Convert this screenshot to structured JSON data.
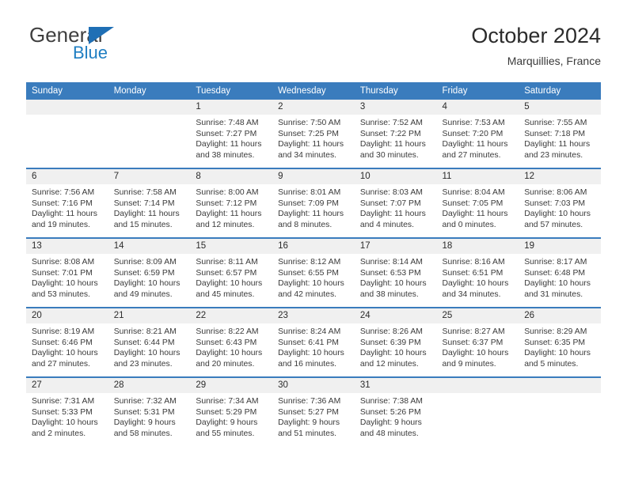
{
  "brand": {
    "name_part1": "General",
    "name_part2": "Blue"
  },
  "header": {
    "title": "October 2024",
    "subtitle": "Marquillies, France"
  },
  "colors": {
    "header_blue": "#3a7cbd",
    "brand_blue": "#1f7ec2",
    "daynum_band": "#f0f0f0",
    "text": "#3a3a3a"
  },
  "weekday_headers": [
    "Sunday",
    "Monday",
    "Tuesday",
    "Wednesday",
    "Thursday",
    "Friday",
    "Saturday"
  ],
  "weeks": [
    [
      {
        "day": "",
        "sunrise": "",
        "sunset": "",
        "daylight_line1": "",
        "daylight_line2": ""
      },
      {
        "day": "",
        "sunrise": "",
        "sunset": "",
        "daylight_line1": "",
        "daylight_line2": ""
      },
      {
        "day": "1",
        "sunrise": "Sunrise: 7:48 AM",
        "sunset": "Sunset: 7:27 PM",
        "daylight_line1": "Daylight: 11 hours",
        "daylight_line2": "and 38 minutes."
      },
      {
        "day": "2",
        "sunrise": "Sunrise: 7:50 AM",
        "sunset": "Sunset: 7:25 PM",
        "daylight_line1": "Daylight: 11 hours",
        "daylight_line2": "and 34 minutes."
      },
      {
        "day": "3",
        "sunrise": "Sunrise: 7:52 AM",
        "sunset": "Sunset: 7:22 PM",
        "daylight_line1": "Daylight: 11 hours",
        "daylight_line2": "and 30 minutes."
      },
      {
        "day": "4",
        "sunrise": "Sunrise: 7:53 AM",
        "sunset": "Sunset: 7:20 PM",
        "daylight_line1": "Daylight: 11 hours",
        "daylight_line2": "and 27 minutes."
      },
      {
        "day": "5",
        "sunrise": "Sunrise: 7:55 AM",
        "sunset": "Sunset: 7:18 PM",
        "daylight_line1": "Daylight: 11 hours",
        "daylight_line2": "and 23 minutes."
      }
    ],
    [
      {
        "day": "6",
        "sunrise": "Sunrise: 7:56 AM",
        "sunset": "Sunset: 7:16 PM",
        "daylight_line1": "Daylight: 11 hours",
        "daylight_line2": "and 19 minutes."
      },
      {
        "day": "7",
        "sunrise": "Sunrise: 7:58 AM",
        "sunset": "Sunset: 7:14 PM",
        "daylight_line1": "Daylight: 11 hours",
        "daylight_line2": "and 15 minutes."
      },
      {
        "day": "8",
        "sunrise": "Sunrise: 8:00 AM",
        "sunset": "Sunset: 7:12 PM",
        "daylight_line1": "Daylight: 11 hours",
        "daylight_line2": "and 12 minutes."
      },
      {
        "day": "9",
        "sunrise": "Sunrise: 8:01 AM",
        "sunset": "Sunset: 7:09 PM",
        "daylight_line1": "Daylight: 11 hours",
        "daylight_line2": "and 8 minutes."
      },
      {
        "day": "10",
        "sunrise": "Sunrise: 8:03 AM",
        "sunset": "Sunset: 7:07 PM",
        "daylight_line1": "Daylight: 11 hours",
        "daylight_line2": "and 4 minutes."
      },
      {
        "day": "11",
        "sunrise": "Sunrise: 8:04 AM",
        "sunset": "Sunset: 7:05 PM",
        "daylight_line1": "Daylight: 11 hours",
        "daylight_line2": "and 0 minutes."
      },
      {
        "day": "12",
        "sunrise": "Sunrise: 8:06 AM",
        "sunset": "Sunset: 7:03 PM",
        "daylight_line1": "Daylight: 10 hours",
        "daylight_line2": "and 57 minutes."
      }
    ],
    [
      {
        "day": "13",
        "sunrise": "Sunrise: 8:08 AM",
        "sunset": "Sunset: 7:01 PM",
        "daylight_line1": "Daylight: 10 hours",
        "daylight_line2": "and 53 minutes."
      },
      {
        "day": "14",
        "sunrise": "Sunrise: 8:09 AM",
        "sunset": "Sunset: 6:59 PM",
        "daylight_line1": "Daylight: 10 hours",
        "daylight_line2": "and 49 minutes."
      },
      {
        "day": "15",
        "sunrise": "Sunrise: 8:11 AM",
        "sunset": "Sunset: 6:57 PM",
        "daylight_line1": "Daylight: 10 hours",
        "daylight_line2": "and 45 minutes."
      },
      {
        "day": "16",
        "sunrise": "Sunrise: 8:12 AM",
        "sunset": "Sunset: 6:55 PM",
        "daylight_line1": "Daylight: 10 hours",
        "daylight_line2": "and 42 minutes."
      },
      {
        "day": "17",
        "sunrise": "Sunrise: 8:14 AM",
        "sunset": "Sunset: 6:53 PM",
        "daylight_line1": "Daylight: 10 hours",
        "daylight_line2": "and 38 minutes."
      },
      {
        "day": "18",
        "sunrise": "Sunrise: 8:16 AM",
        "sunset": "Sunset: 6:51 PM",
        "daylight_line1": "Daylight: 10 hours",
        "daylight_line2": "and 34 minutes."
      },
      {
        "day": "19",
        "sunrise": "Sunrise: 8:17 AM",
        "sunset": "Sunset: 6:48 PM",
        "daylight_line1": "Daylight: 10 hours",
        "daylight_line2": "and 31 minutes."
      }
    ],
    [
      {
        "day": "20",
        "sunrise": "Sunrise: 8:19 AM",
        "sunset": "Sunset: 6:46 PM",
        "daylight_line1": "Daylight: 10 hours",
        "daylight_line2": "and 27 minutes."
      },
      {
        "day": "21",
        "sunrise": "Sunrise: 8:21 AM",
        "sunset": "Sunset: 6:44 PM",
        "daylight_line1": "Daylight: 10 hours",
        "daylight_line2": "and 23 minutes."
      },
      {
        "day": "22",
        "sunrise": "Sunrise: 8:22 AM",
        "sunset": "Sunset: 6:43 PM",
        "daylight_line1": "Daylight: 10 hours",
        "daylight_line2": "and 20 minutes."
      },
      {
        "day": "23",
        "sunrise": "Sunrise: 8:24 AM",
        "sunset": "Sunset: 6:41 PM",
        "daylight_line1": "Daylight: 10 hours",
        "daylight_line2": "and 16 minutes."
      },
      {
        "day": "24",
        "sunrise": "Sunrise: 8:26 AM",
        "sunset": "Sunset: 6:39 PM",
        "daylight_line1": "Daylight: 10 hours",
        "daylight_line2": "and 12 minutes."
      },
      {
        "day": "25",
        "sunrise": "Sunrise: 8:27 AM",
        "sunset": "Sunset: 6:37 PM",
        "daylight_line1": "Daylight: 10 hours",
        "daylight_line2": "and 9 minutes."
      },
      {
        "day": "26",
        "sunrise": "Sunrise: 8:29 AM",
        "sunset": "Sunset: 6:35 PM",
        "daylight_line1": "Daylight: 10 hours",
        "daylight_line2": "and 5 minutes."
      }
    ],
    [
      {
        "day": "27",
        "sunrise": "Sunrise: 7:31 AM",
        "sunset": "Sunset: 5:33 PM",
        "daylight_line1": "Daylight: 10 hours",
        "daylight_line2": "and 2 minutes."
      },
      {
        "day": "28",
        "sunrise": "Sunrise: 7:32 AM",
        "sunset": "Sunset: 5:31 PM",
        "daylight_line1": "Daylight: 9 hours",
        "daylight_line2": "and 58 minutes."
      },
      {
        "day": "29",
        "sunrise": "Sunrise: 7:34 AM",
        "sunset": "Sunset: 5:29 PM",
        "daylight_line1": "Daylight: 9 hours",
        "daylight_line2": "and 55 minutes."
      },
      {
        "day": "30",
        "sunrise": "Sunrise: 7:36 AM",
        "sunset": "Sunset: 5:27 PM",
        "daylight_line1": "Daylight: 9 hours",
        "daylight_line2": "and 51 minutes."
      },
      {
        "day": "31",
        "sunrise": "Sunrise: 7:38 AM",
        "sunset": "Sunset: 5:26 PM",
        "daylight_line1": "Daylight: 9 hours",
        "daylight_line2": "and 48 minutes."
      },
      {
        "day": "",
        "sunrise": "",
        "sunset": "",
        "daylight_line1": "",
        "daylight_line2": ""
      },
      {
        "day": "",
        "sunrise": "",
        "sunset": "",
        "daylight_line1": "",
        "daylight_line2": ""
      }
    ]
  ]
}
